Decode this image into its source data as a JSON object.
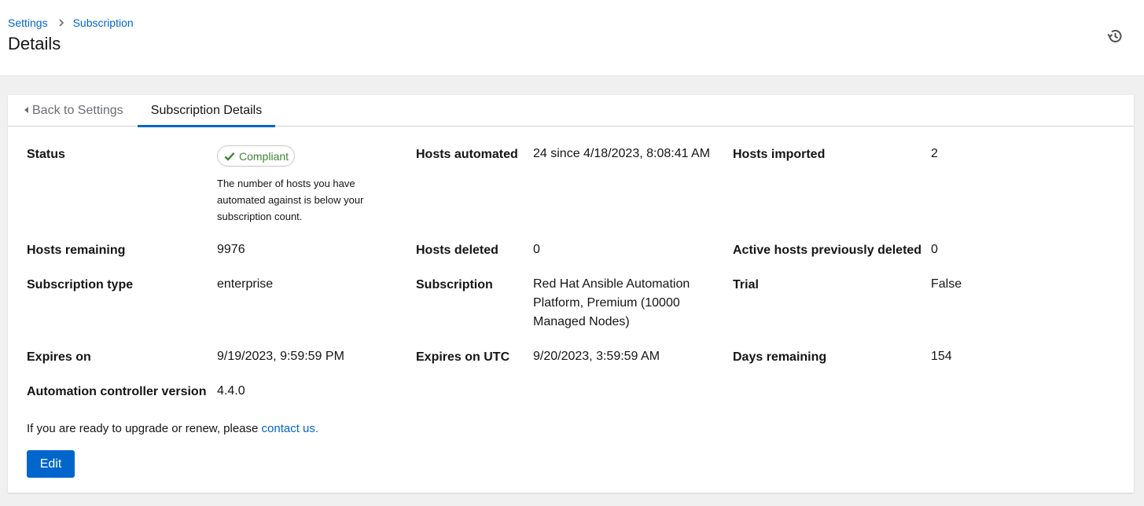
{
  "breadcrumb": {
    "settings": "Settings",
    "subscription": "Subscription"
  },
  "page_title": "Details",
  "tabs": {
    "back": "Back to Settings",
    "active": "Subscription Details"
  },
  "status": {
    "label": "Status",
    "badge": "Compliant",
    "help": "The number of hosts you have automated against is below your subscription count."
  },
  "fields": {
    "hosts_automated": {
      "label": "Hosts automated",
      "value": "24 since 4/18/2023, 8:08:41 AM"
    },
    "hosts_imported": {
      "label": "Hosts imported",
      "value": "2"
    },
    "hosts_remaining": {
      "label": "Hosts remaining",
      "value": "9976"
    },
    "hosts_deleted": {
      "label": "Hosts deleted",
      "value": "0"
    },
    "active_hosts_previously_deleted": {
      "label": "Active hosts previously deleted",
      "value": "0"
    },
    "subscription_type": {
      "label": "Subscription type",
      "value": "enterprise"
    },
    "subscription": {
      "label": "Subscription",
      "value": "Red Hat Ansible Automation Platform, Premium (10000 Managed Nodes)"
    },
    "trial": {
      "label": "Trial",
      "value": "False"
    },
    "expires_on": {
      "label": "Expires on",
      "value": "9/19/2023, 9:59:59 PM"
    },
    "expires_on_utc": {
      "label": "Expires on UTC",
      "value": "9/20/2023, 3:59:59 AM"
    },
    "days_remaining": {
      "label": "Days remaining",
      "value": "154"
    },
    "controller_version": {
      "label": "Automation controller version",
      "value": "4.4.0"
    }
  },
  "upgrade": {
    "text": "If you are ready to upgrade or renew, please ",
    "link": "contact us."
  },
  "edit_button": "Edit",
  "icons": {
    "history": "history-icon",
    "check": "check-icon",
    "separator": "chevron-right-icon",
    "back_caret": "caret-left-icon"
  },
  "colors": {
    "link": "#0066cc",
    "success": "#3e8635",
    "primary": "#0066cc"
  }
}
